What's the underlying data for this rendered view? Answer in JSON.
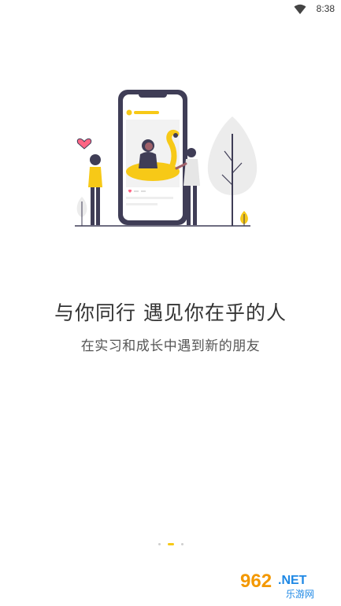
{
  "status_bar": {
    "time": "8:38",
    "icons": [
      "wifi-icon"
    ]
  },
  "onboarding": {
    "headline": "与你同行 遇见你在乎的人",
    "subheadline": "在实习和成长中遇到新的朋友",
    "illustration_icon": "phone-social-illustration",
    "page_indicator": {
      "total": 3,
      "current": 2
    }
  },
  "watermark": {
    "number": "962",
    "suffix": ".NET",
    "site_name": "乐游网"
  },
  "colors": {
    "accent": "#f7c917",
    "text_primary": "#333333",
    "text_secondary": "#555555",
    "dot_inactive": "#cfcfcf"
  }
}
